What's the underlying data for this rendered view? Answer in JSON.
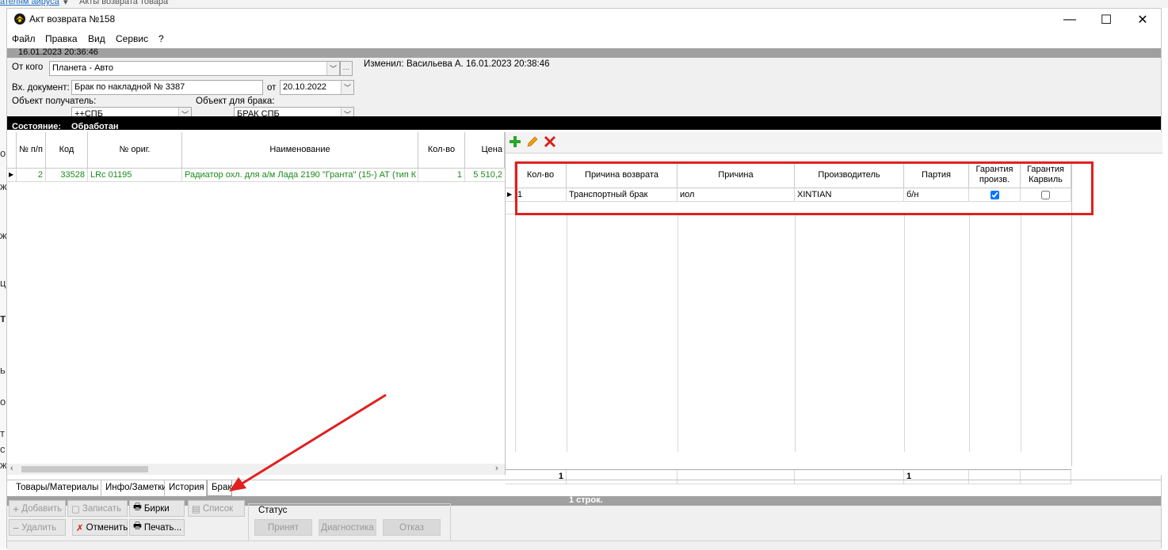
{
  "background_app": {
    "crumb1": "ателям айруса",
    "crumb2": "Акты возврата товара"
  },
  "window": {
    "title": "Акт возврата №158",
    "controls": {
      "minimize": "—",
      "maximize": "☐",
      "close": "✕"
    }
  },
  "menu": [
    "Файл",
    "Правка",
    "Вид",
    "Сервис",
    "?"
  ],
  "header": {
    "created": "16.01.2023 20:36:46",
    "from_label": "От кого",
    "from_value": "Планета - Авто",
    "changed_label": "Изменил:",
    "changed_value": "Васильева А.  16.01.2023 20:38:46",
    "doc_label": "Вх. документ:",
    "doc_value": "Брак по накладной № 3387",
    "date_label": "от",
    "date_value": "20.10.2022",
    "recipient_label": "Объект получатель:",
    "recipient_value": "++СПБ",
    "defect_obj_label": "Объект для брака:",
    "defect_obj_value": "БРАК СПБ"
  },
  "state": {
    "label": "Состояние:",
    "value": "Обработан"
  },
  "goods_grid": {
    "columns": [
      "№ п/п",
      "Код",
      "№ ориг.",
      "Наименование",
      "Кол-во",
      "Цена"
    ],
    "rows": [
      {
        "num": "2",
        "code": "33528",
        "orig": "LRc 01195",
        "name": "Радиатор охл. для а/м Лада 2190 \"Гранта\" (15-) АТ (тип К",
        "qty": "1",
        "price": "5 510,2"
      }
    ]
  },
  "defect_grid": {
    "columns": [
      "Кол-во",
      "Причина возврата",
      "Причина",
      "Производитель",
      "Партия",
      "Гарантия произв.",
      "Гарантия Карвиль"
    ],
    "rows": [
      {
        "qty": "1",
        "return_reason": "Транспортный брак",
        "reason": "иол",
        "manufacturer": "XINTIAN",
        "batch": "б/н",
        "warranty_mfr": true,
        "warranty_karvil": false
      }
    ],
    "footer": {
      "qty_total": "1",
      "batch_total": "1"
    }
  },
  "tabs": [
    "Товары/Материалы",
    "Инфо/Заметки",
    "История",
    "Брак"
  ],
  "status_strip": "1 строк.",
  "toolbar": {
    "add": "Добавить",
    "save": "Записать",
    "tags": "Бирки",
    "list": "Список",
    "delete": "Удалить",
    "cancel": "Отменить",
    "print": "Печать..."
  },
  "status_group": {
    "title": "Статус",
    "accepted": "Принят",
    "diagnostics": "Диагностика",
    "rejected": "Отказ"
  },
  "colors": {
    "annotation": "#e02020",
    "green_text": "#1a8a1a"
  }
}
